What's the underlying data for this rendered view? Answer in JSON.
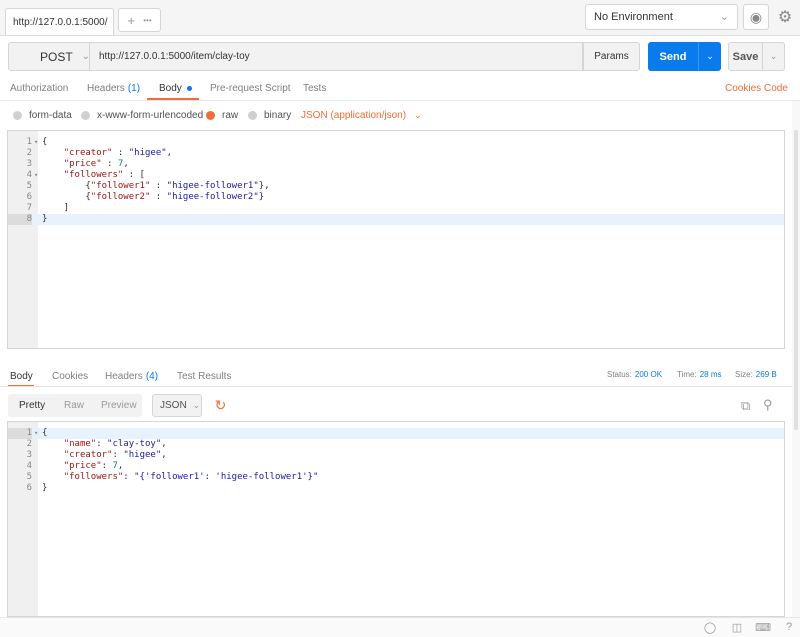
{
  "tab": {
    "url": "http://127.0.0.1:5000/"
  },
  "new_tab": {
    "plus": "+",
    "more": "•••"
  },
  "environment": {
    "label": "No Environment"
  },
  "request": {
    "method": "POST",
    "url": "http://127.0.0.1:5000/item/clay-toy",
    "params_label": "Params",
    "send_label": "Send",
    "save_label": "Save"
  },
  "request_tabs": {
    "authorization": "Authorization",
    "headers": "Headers",
    "headers_count": "(1)",
    "body": "Body",
    "prerequest": "Pre-request Script",
    "tests": "Tests",
    "cookies": "Cookies",
    "code": "Code"
  },
  "body_types": {
    "form_data": "form-data",
    "urlencoded": "x-www-form-urlencoded",
    "raw": "raw",
    "binary": "binary",
    "selected": "raw",
    "content_type": "JSON (application/json)"
  },
  "request_body_lines": [
    {
      "n": "1",
      "fold": true,
      "text": "{"
    },
    {
      "n": "2",
      "text": "    \"creator\" : \"higee\","
    },
    {
      "n": "3",
      "text": "    \"price\" : 7,"
    },
    {
      "n": "4",
      "fold": true,
      "text": "    \"followers\" : ["
    },
    {
      "n": "5",
      "text": "        {\"follower1\" : \"higee-follower1\"},"
    },
    {
      "n": "6",
      "text": "        {\"follower2\" : \"higee-follower2\"}"
    },
    {
      "n": "7",
      "text": "    ]"
    },
    {
      "n": "8",
      "active": true,
      "text": "}"
    }
  ],
  "response_tabs": {
    "body": "Body",
    "cookies": "Cookies",
    "headers": "Headers",
    "headers_count": "(4)",
    "test_results": "Test Results"
  },
  "response_status": {
    "status_label": "Status:",
    "status_value": "200 OK",
    "time_label": "Time:",
    "time_value": "28 ms",
    "size_label": "Size:",
    "size_value": "269 B"
  },
  "response_view": {
    "pretty": "Pretty",
    "raw": "Raw",
    "preview": "Preview",
    "language": "JSON"
  },
  "response_body_lines": [
    {
      "n": "1",
      "fold": true,
      "active": true,
      "text": "{"
    },
    {
      "n": "2",
      "text": "    \"name\": \"clay-toy\","
    },
    {
      "n": "3",
      "text": "    \"creator\": \"higee\","
    },
    {
      "n": "4",
      "text": "    \"price\": 7,"
    },
    {
      "n": "5",
      "text": "    \"followers\": \"{'follower1': 'higee-follower1'}\""
    },
    {
      "n": "6",
      "text": "}"
    }
  ],
  "colors": {
    "accent_orange": "#f26b3a",
    "accent_blue": "#097bed"
  }
}
